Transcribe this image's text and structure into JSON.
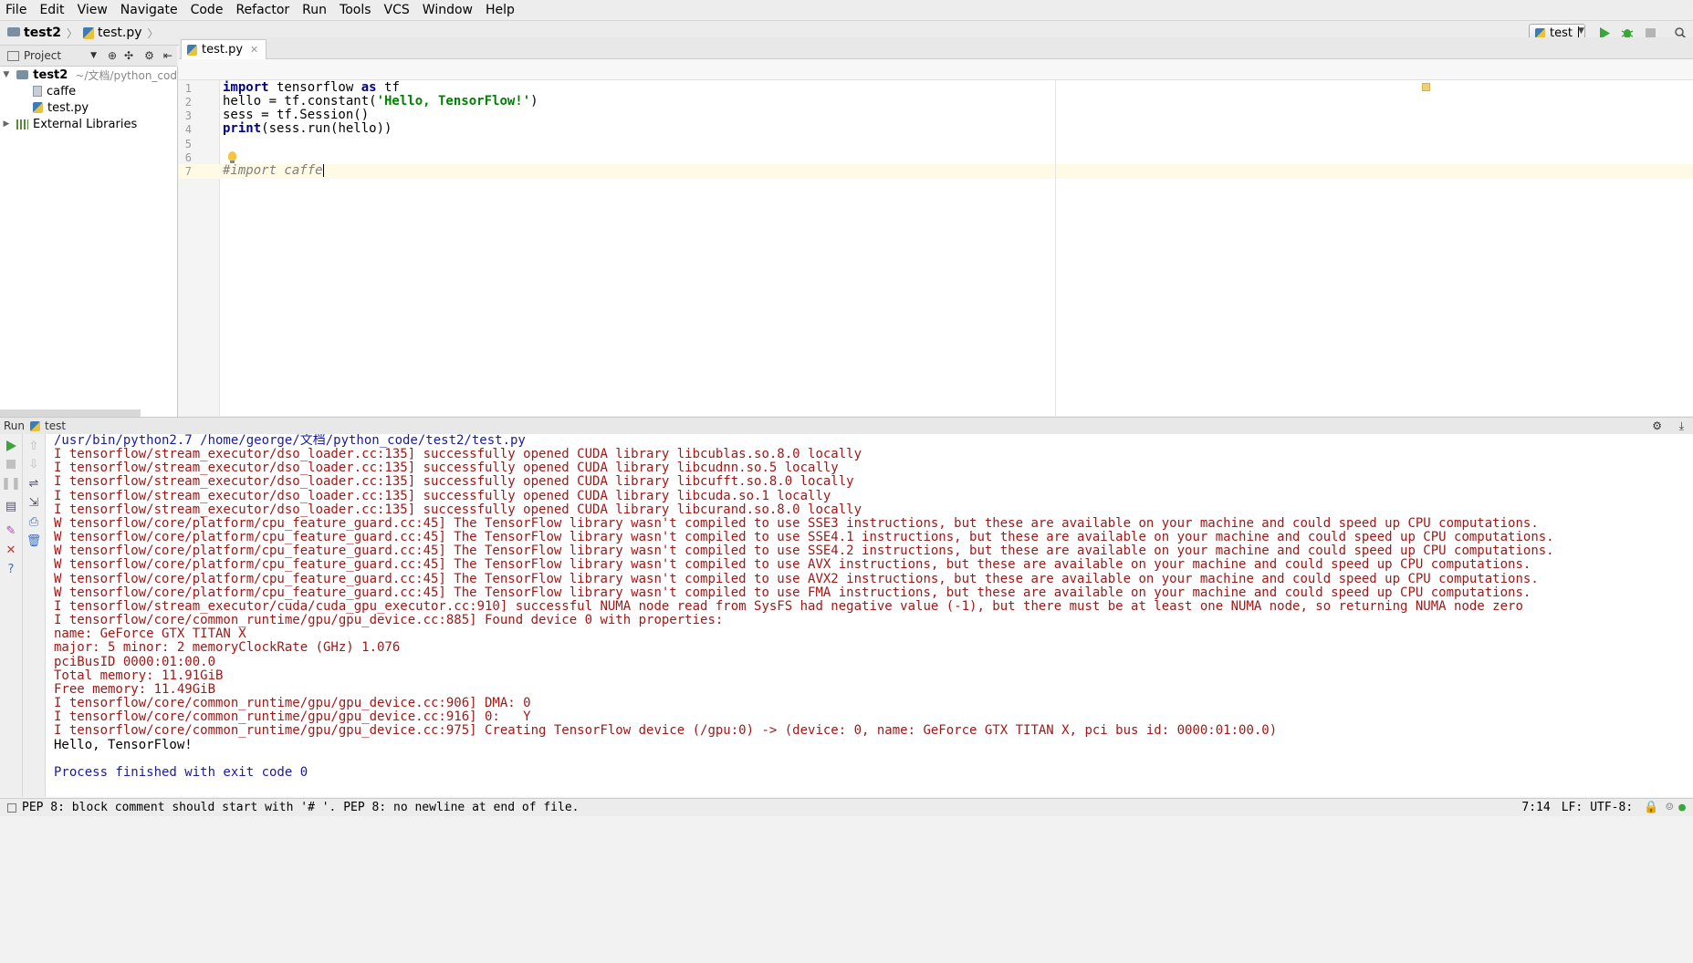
{
  "menubar": {
    "items": [
      {
        "label": "File"
      },
      {
        "label": "Edit"
      },
      {
        "label": "View"
      },
      {
        "label": "Navigate"
      },
      {
        "label": "Code"
      },
      {
        "label": "Refactor"
      },
      {
        "label": "Run"
      },
      {
        "label": "Tools"
      },
      {
        "label": "VCS"
      },
      {
        "label": "Window"
      },
      {
        "label": "Help"
      }
    ]
  },
  "navbar": {
    "project": "test2",
    "file": "test.py",
    "run_config": "test"
  },
  "project_panel": {
    "title": "Project",
    "root": "test2",
    "root_path": "~/文档/python_cod",
    "children": [
      "caffe",
      "test.py"
    ],
    "external": "External Libraries"
  },
  "editor": {
    "tab": "test.py",
    "lines": [
      {
        "no": "1"
      },
      {
        "no": "2"
      },
      {
        "no": "3"
      },
      {
        "no": "4"
      },
      {
        "no": "5"
      },
      {
        "no": "6"
      },
      {
        "no": "7"
      }
    ],
    "code": {
      "l1_kw": "import",
      "l1_rest": " tensorflow ",
      "l1_kw2": "as",
      "l1_end": " tf",
      "l2_a": "hello = tf.constant(",
      "l2_str": "'Hello, TensorFlow!'",
      "l2_b": ")",
      "l3": "sess = tf.Session()",
      "l4_kw": "print",
      "l4_rest": "(sess.run(hello))",
      "l7": "#import caffe"
    }
  },
  "run_panel": {
    "label": "Run",
    "config": "test",
    "console": [
      {
        "text": "/usr/bin/python2.7 /home/george/文档/python_code/test2/test.py",
        "kind": "blue"
      },
      {
        "text": "I tensorflow/stream_executor/dso_loader.cc:135] successfully opened CUDA library libcublas.so.8.0 locally",
        "kind": "err"
      },
      {
        "text": "I tensorflow/stream_executor/dso_loader.cc:135] successfully opened CUDA library libcudnn.so.5 locally",
        "kind": "err"
      },
      {
        "text": "I tensorflow/stream_executor/dso_loader.cc:135] successfully opened CUDA library libcufft.so.8.0 locally",
        "kind": "err"
      },
      {
        "text": "I tensorflow/stream_executor/dso_loader.cc:135] successfully opened CUDA library libcuda.so.1 locally",
        "kind": "err"
      },
      {
        "text": "I tensorflow/stream_executor/dso_loader.cc:135] successfully opened CUDA library libcurand.so.8.0 locally",
        "kind": "err"
      },
      {
        "text": "W tensorflow/core/platform/cpu_feature_guard.cc:45] The TensorFlow library wasn't compiled to use SSE3 instructions, but these are available on your machine and could speed up CPU computations.",
        "kind": "err"
      },
      {
        "text": "W tensorflow/core/platform/cpu_feature_guard.cc:45] The TensorFlow library wasn't compiled to use SSE4.1 instructions, but these are available on your machine and could speed up CPU computations.",
        "kind": "err"
      },
      {
        "text": "W tensorflow/core/platform/cpu_feature_guard.cc:45] The TensorFlow library wasn't compiled to use SSE4.2 instructions, but these are available on your machine and could speed up CPU computations.",
        "kind": "err"
      },
      {
        "text": "W tensorflow/core/platform/cpu_feature_guard.cc:45] The TensorFlow library wasn't compiled to use AVX instructions, but these are available on your machine and could speed up CPU computations.",
        "kind": "err"
      },
      {
        "text": "W tensorflow/core/platform/cpu_feature_guard.cc:45] The TensorFlow library wasn't compiled to use AVX2 instructions, but these are available on your machine and could speed up CPU computations.",
        "kind": "err"
      },
      {
        "text": "W tensorflow/core/platform/cpu_feature_guard.cc:45] The TensorFlow library wasn't compiled to use FMA instructions, but these are available on your machine and could speed up CPU computations.",
        "kind": "err"
      },
      {
        "text": "I tensorflow/stream_executor/cuda/cuda_gpu_executor.cc:910] successful NUMA node read from SysFS had negative value (-1), but there must be at least one NUMA node, so returning NUMA node zero",
        "kind": "err"
      },
      {
        "text": "I tensorflow/core/common_runtime/gpu/gpu_device.cc:885] Found device 0 with properties:",
        "kind": "err"
      },
      {
        "text": "name: GeForce GTX TITAN X",
        "kind": "err"
      },
      {
        "text": "major: 5 minor: 2 memoryClockRate (GHz) 1.076",
        "kind": "err"
      },
      {
        "text": "pciBusID 0000:01:00.0",
        "kind": "err"
      },
      {
        "text": "Total memory: 11.91GiB",
        "kind": "err"
      },
      {
        "text": "Free memory: 11.49GiB",
        "kind": "err"
      },
      {
        "text": "I tensorflow/core/common_runtime/gpu/gpu_device.cc:906] DMA: 0",
        "kind": "err"
      },
      {
        "text": "I tensorflow/core/common_runtime/gpu/gpu_device.cc:916] 0:   Y",
        "kind": "err"
      },
      {
        "text": "I tensorflow/core/common_runtime/gpu/gpu_device.cc:975] Creating TensorFlow device (/gpu:0) -> (device: 0, name: GeForce GTX TITAN X, pci bus id: 0000:01:00.0)",
        "kind": "err"
      },
      {
        "text": "Hello, TensorFlow!",
        "kind": "norm"
      },
      {
        "text": "",
        "kind": "norm"
      },
      {
        "text": "Process finished with exit code 0",
        "kind": "blue"
      }
    ]
  },
  "statusbar": {
    "message": "PEP 8: block comment should start with '# '. PEP 8: no newline at end of file.",
    "position": "7:14",
    "line_sep": "LF:",
    "encoding": "UTF-8:"
  },
  "colors": {
    "keyword": "#000080",
    "string": "#008000",
    "stderr": "#a01818",
    "console_blue": "#1a1a9e"
  }
}
